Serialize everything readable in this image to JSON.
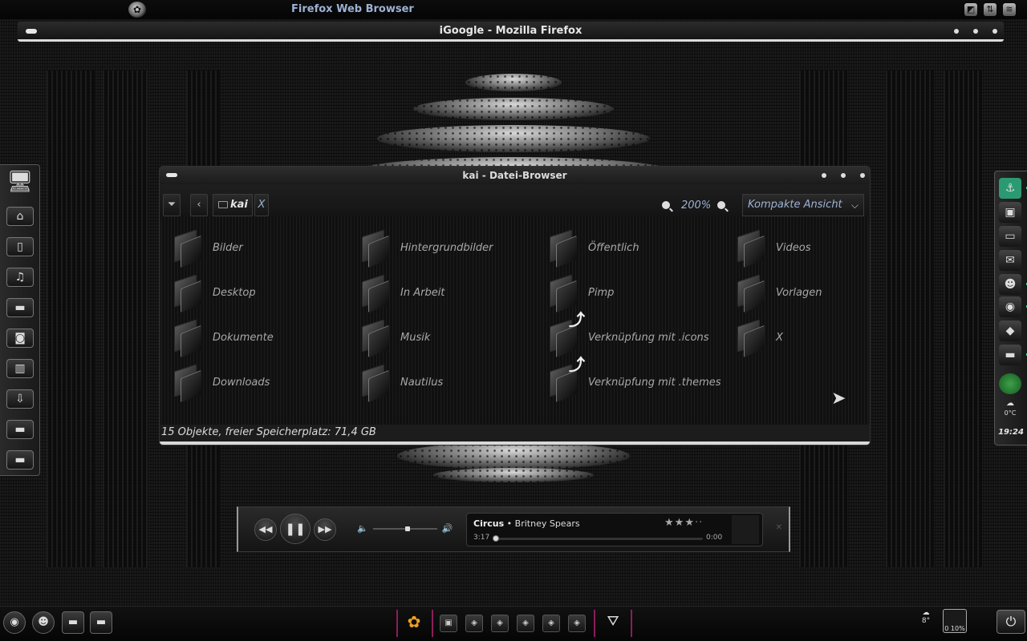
{
  "top_panel": {
    "app_title": "Firefox Web Browser",
    "menu_icon": "gnome-foot-icon",
    "tray_icons": [
      "window-list-icon",
      "network-icon",
      "wifi-icon"
    ]
  },
  "firefox_window": {
    "title": "iGoogle - Mozilla Firefox"
  },
  "launcher": {
    "items": [
      "desktop-icon",
      "home-icon",
      "document-icon",
      "music-icon",
      "drive-icon",
      "camera-icon",
      "film-icon",
      "download-icon",
      "drive-icon",
      "drive-icon"
    ]
  },
  "file_browser": {
    "title": "kai - Datei-Browser",
    "location": "kai",
    "close_tab": "X",
    "zoom": "200%",
    "view_mode": "Kompakte Ansicht",
    "items": [
      {
        "name": "Bilder",
        "link": false
      },
      {
        "name": "Desktop",
        "link": false
      },
      {
        "name": "Dokumente",
        "link": false
      },
      {
        "name": "Downloads",
        "link": false
      },
      {
        "name": "Hintergrundbilder",
        "link": false
      },
      {
        "name": "In Arbeit",
        "link": false
      },
      {
        "name": "Musik",
        "link": false
      },
      {
        "name": "Nautilus",
        "link": false
      },
      {
        "name": "Öffentlich",
        "link": false
      },
      {
        "name": "Pimp",
        "link": false
      },
      {
        "name": "Verknüpfung mit .icons",
        "link": true
      },
      {
        "name": "Verknüpfung mit .themes",
        "link": true
      },
      {
        "name": "Videos",
        "link": false
      },
      {
        "name": "Vorlagen",
        "link": false
      },
      {
        "name": "X",
        "link": false
      }
    ],
    "status": "15 Objekte, freier Speicherplatz: 71,4 GB"
  },
  "dock": {
    "items": [
      "anchor-icon",
      "screenshot-icon",
      "terminal-icon",
      "mail-icon",
      "pidgin-icon",
      "firefox-icon",
      "gem-icon",
      "drive-icon",
      "green-dot-icon"
    ],
    "temperature": "0°C",
    "clock": "19:24",
    "accent": "#2fe08a"
  },
  "player": {
    "song": "Circus",
    "artist": "Britney Spears",
    "elapsed": "3:17",
    "remaining": "0:00",
    "rating": 3,
    "max_rating": 5,
    "volume": 0.55,
    "progress": 0.0
  },
  "bottom_panel": {
    "left_icons": [
      "firefox-icon",
      "pidgin-icon",
      "drive-icon",
      "drive-icon"
    ],
    "center_icons": [
      "gnome-foot-icon",
      "screen-icon",
      "workspace-icon",
      "workspace-icon",
      "workspace-icon",
      "workspace-icon",
      "workspace-icon",
      "trash-icon"
    ],
    "weather_temp": "8°",
    "sysmon": "0 10%",
    "power": "power-icon",
    "separator_color": "#8a1e5a"
  }
}
